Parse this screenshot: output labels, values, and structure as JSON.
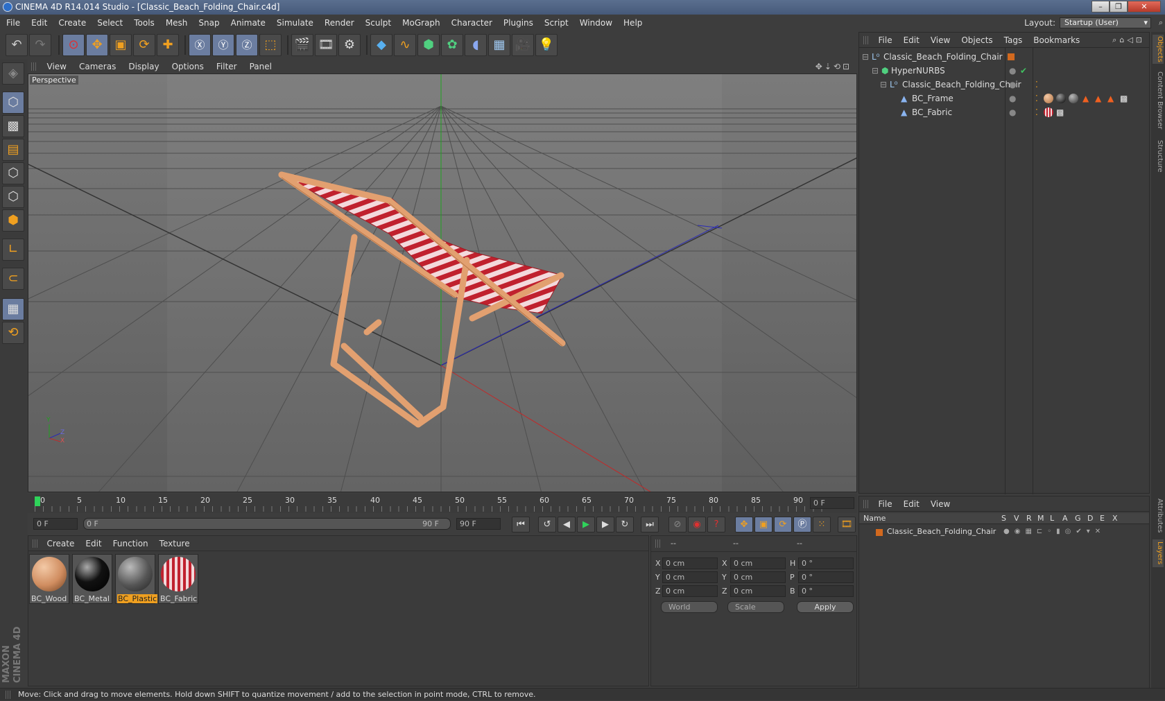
{
  "window": {
    "title": "CINEMA 4D R14.014 Studio - [Classic_Beach_Folding_Chair.c4d]"
  },
  "menubar": {
    "items": [
      "File",
      "Edit",
      "Create",
      "Select",
      "Tools",
      "Mesh",
      "Snap",
      "Animate",
      "Simulate",
      "Render",
      "Sculpt",
      "MoGraph",
      "Character",
      "Plugins",
      "Script",
      "Window",
      "Help"
    ],
    "layout_label": "Layout:",
    "layout_value": "Startup (User)"
  },
  "viewport": {
    "menu": [
      "View",
      "Cameras",
      "Display",
      "Options",
      "Filter",
      "Panel"
    ],
    "camera_label": "Perspective",
    "axis": {
      "y": "Y",
      "z": "Z",
      "x": "X"
    }
  },
  "timeline": {
    "ticks": [
      "0",
      "5",
      "10",
      "15",
      "20",
      "25",
      "30",
      "35",
      "40",
      "45",
      "50",
      "55",
      "60",
      "65",
      "70",
      "75",
      "80",
      "85",
      "90"
    ],
    "current_frame": "0 F"
  },
  "transport": {
    "start_field": "0 F",
    "range_start": "0 F",
    "range_end": "90 F",
    "end_field": "90 F"
  },
  "materials": {
    "menu": [
      "Create",
      "Edit",
      "Function",
      "Texture"
    ],
    "items": [
      {
        "name": "BC_Wood",
        "selected": false
      },
      {
        "name": "BC_Metal",
        "selected": false
      },
      {
        "name": "BC_Plastic",
        "selected": true
      },
      {
        "name": "BC_Fabric",
        "selected": false
      }
    ]
  },
  "coordinates": {
    "headers": [
      "--",
      "--",
      "--"
    ],
    "rows": [
      {
        "a": "X",
        "av": "0 cm",
        "b": "X",
        "bv": "0 cm",
        "c": "H",
        "cv": "0 °"
      },
      {
        "a": "Y",
        "av": "0 cm",
        "b": "Y",
        "bv": "0 cm",
        "c": "P",
        "cv": "0 °"
      },
      {
        "a": "Z",
        "av": "0 cm",
        "b": "Z",
        "bv": "0 cm",
        "c": "B",
        "cv": "0 °"
      }
    ],
    "mode": "World",
    "type": "Scale",
    "apply": "Apply"
  },
  "objects": {
    "menu": [
      "File",
      "Edit",
      "View",
      "Objects",
      "Tags",
      "Bookmarks"
    ],
    "tree": [
      {
        "name": "Classic_Beach_Folding_Chair",
        "indent": 0
      },
      {
        "name": "HyperNURBS",
        "indent": 1
      },
      {
        "name": "Classic_Beach_Folding_Chair",
        "indent": 2
      },
      {
        "name": "BC_Frame",
        "indent": 3
      },
      {
        "name": "BC_Fabric",
        "indent": 3
      }
    ]
  },
  "layers": {
    "menu": [
      "File",
      "Edit",
      "View"
    ],
    "columns": [
      "Name",
      "S",
      "V",
      "R",
      "M",
      "L",
      "A",
      "G",
      "D",
      "E",
      "X"
    ],
    "rows": [
      {
        "name": "Classic_Beach_Folding_Chair"
      }
    ]
  },
  "sidetabs": [
    "Objects",
    "Content Browser",
    "Structure",
    "Attributes",
    "Layers"
  ],
  "branding": "MAXON CINEMA 4D",
  "status": "Move: Click and drag to move elements. Hold down SHIFT to quantize movement / add to the selection in point mode, CTRL to remove.",
  "colors": {
    "accent": "#f0a020",
    "selection": "#6b7da0",
    "fabric_red": "#c0212e",
    "wood": "#e2a070"
  }
}
